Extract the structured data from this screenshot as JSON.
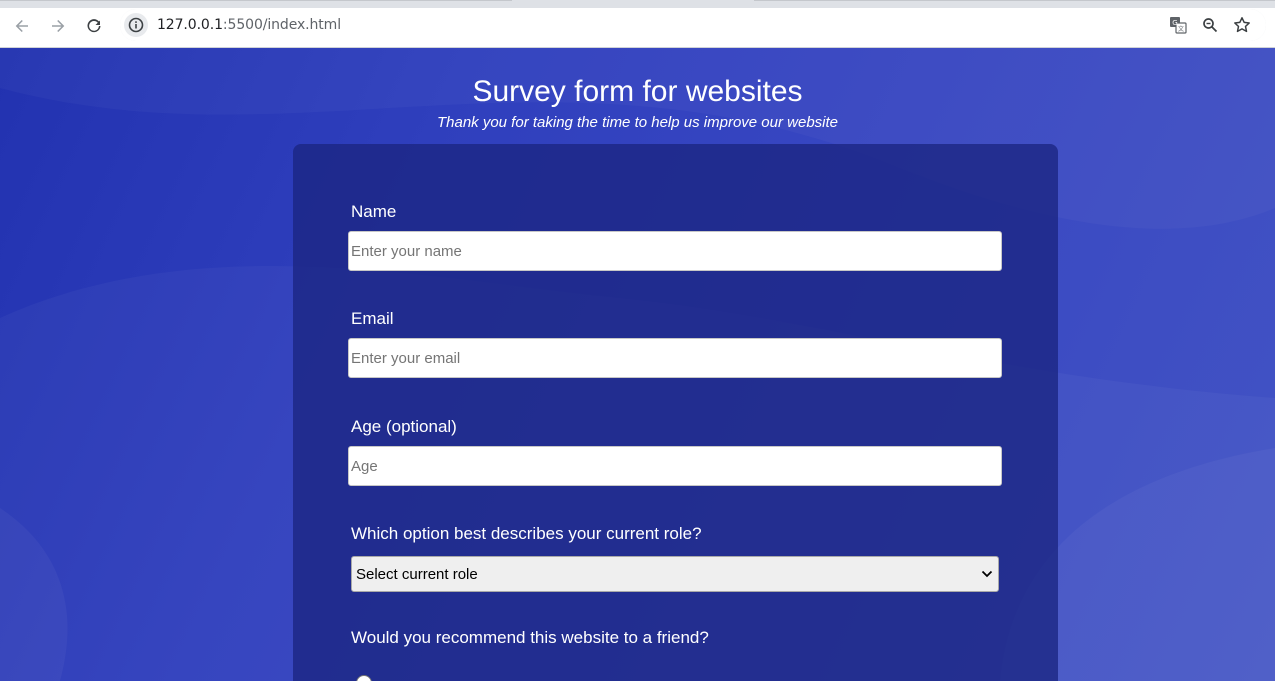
{
  "browser": {
    "url_host": "127.0.0.1",
    "url_rest": ":5500/index.html"
  },
  "header": {
    "title": "Survey form for websites",
    "subtitle": "Thank you for taking the time to help us improve our website"
  },
  "form": {
    "name": {
      "label": "Name",
      "placeholder": "Enter your name"
    },
    "email": {
      "label": "Email",
      "placeholder": "Enter your email"
    },
    "age": {
      "label": "Age (optional)",
      "placeholder": "Age"
    },
    "role": {
      "label": "Which option best describes your current role?",
      "selected": "Select current role"
    },
    "recommend": {
      "label": "Would you recommend this website to a friend?"
    }
  },
  "colors": {
    "page_bg": "#2f3fbd",
    "card_bg": "#1b2582"
  },
  "icons": [
    "back-arrow-icon",
    "forward-arrow-icon",
    "reload-icon",
    "info-icon",
    "translate-icon",
    "zoom-icon",
    "star-icon",
    "chevron-down-icon"
  ]
}
